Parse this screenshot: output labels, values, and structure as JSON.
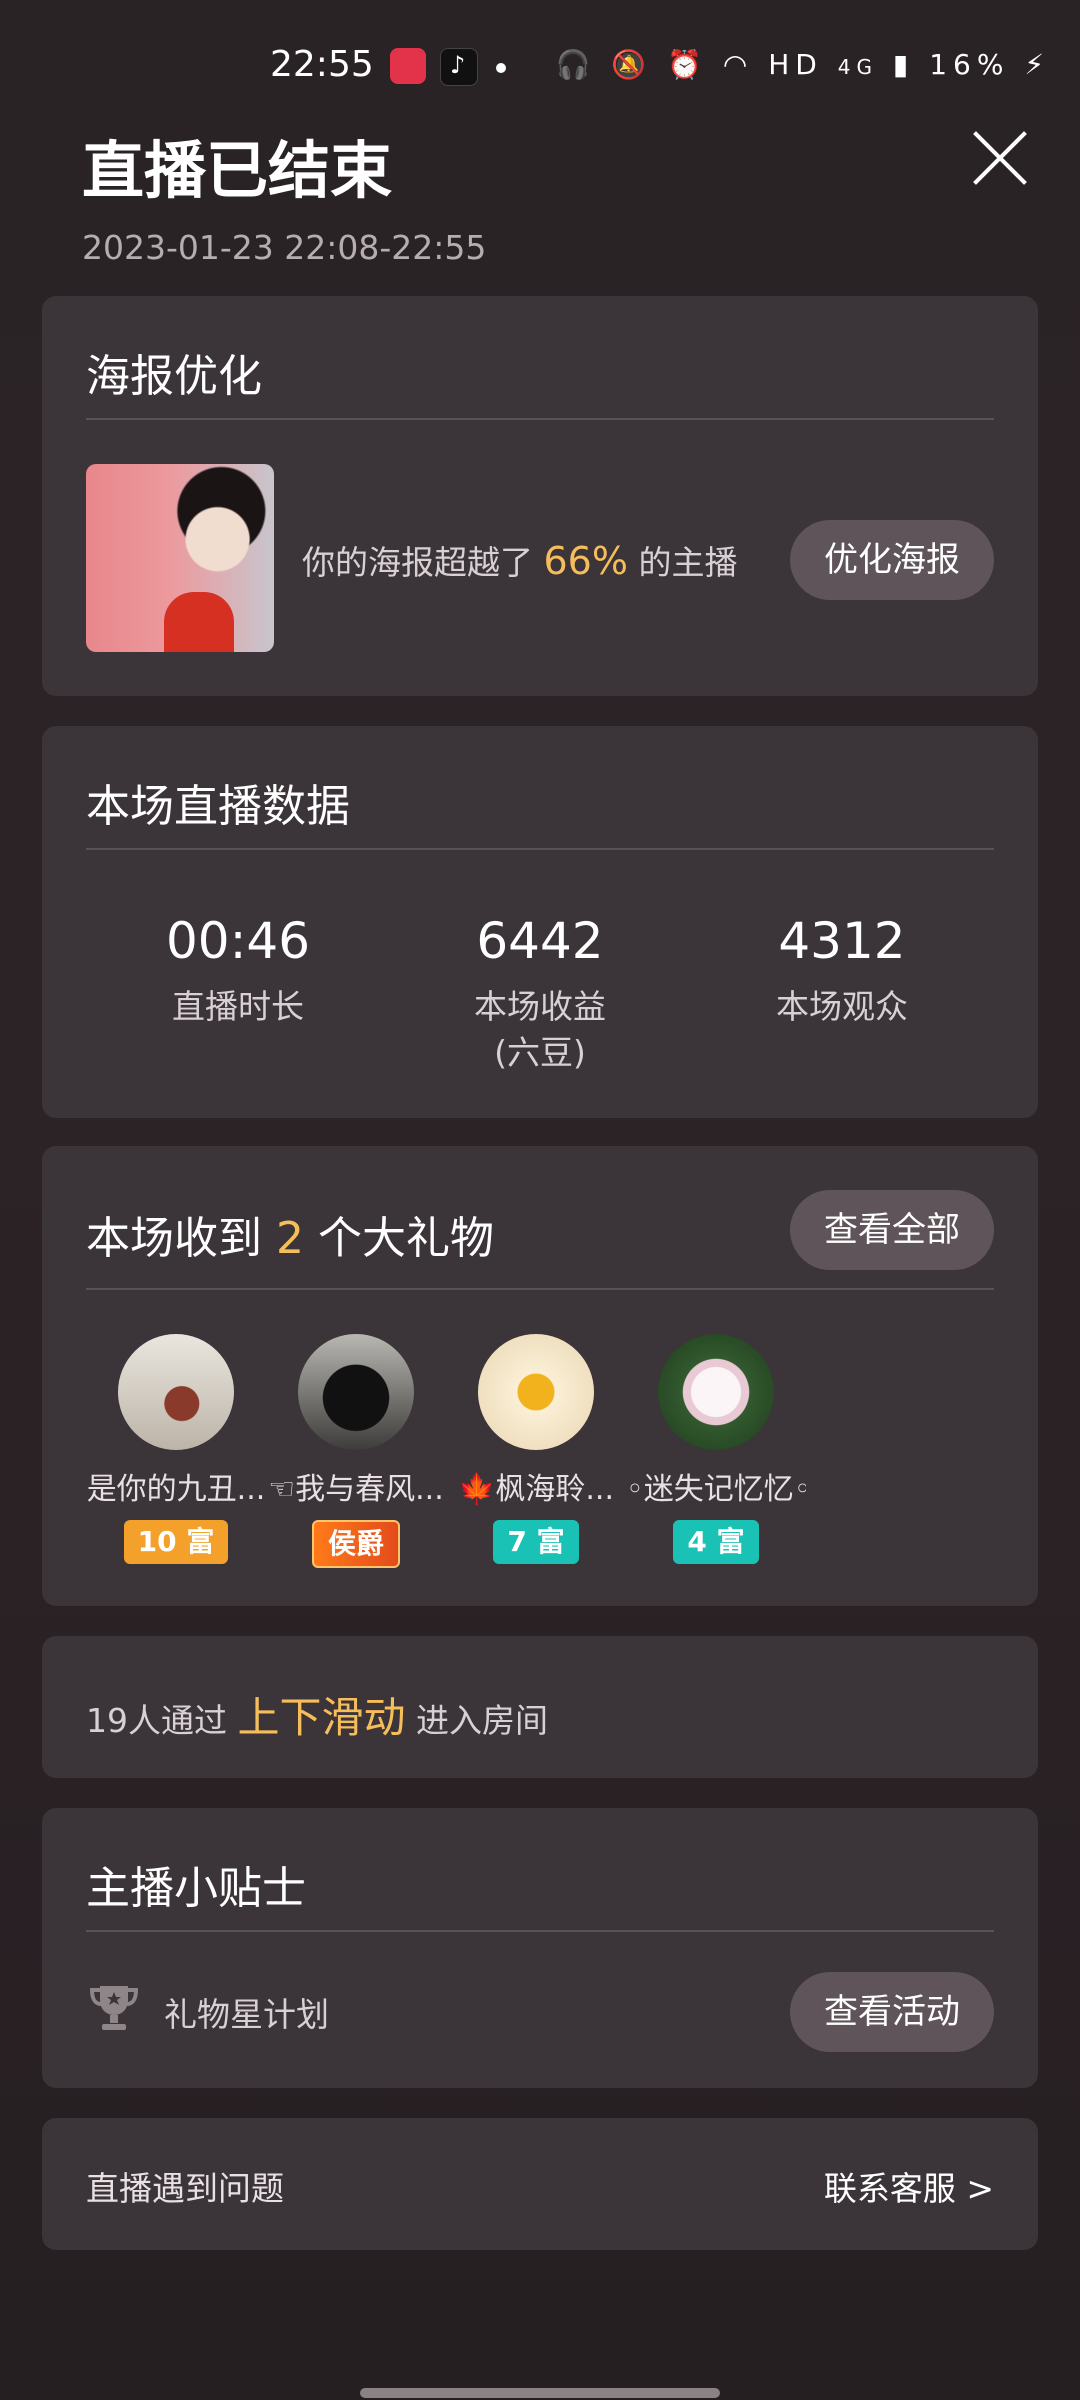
{
  "status_bar": {
    "time": "22:55",
    "network": "HD",
    "cellular": "4G",
    "battery": "16%",
    "icons": [
      "headset-icon",
      "mute-icon",
      "alarm-icon",
      "wifi-icon",
      "signal-icon",
      "charging-icon"
    ]
  },
  "header": {
    "title": "直播已结束",
    "date_range": "2023-01-23 22:08-22:55",
    "close_icon": "close-icon"
  },
  "poster": {
    "title": "海报优化",
    "text_before": "你的海报超越了",
    "percent": "66%",
    "text_after": "的主播",
    "button": "优化海报"
  },
  "live_data": {
    "title": "本场直播数据",
    "stats": [
      {
        "value": "00:46",
        "label": "直播时长",
        "sublabel": ""
      },
      {
        "value": "6442",
        "label": "本场收益",
        "sublabel": "(六豆)"
      },
      {
        "value": "4312",
        "label": "本场观众",
        "sublabel": ""
      }
    ]
  },
  "gifts": {
    "title_before": "本场收到",
    "count": "2",
    "title_after": "个大礼物",
    "button": "查看全部",
    "gifters": [
      {
        "name": "是你的九丑...",
        "badge": "10 富"
      },
      {
        "name": "☜我与春风...",
        "badge": "侯爵"
      },
      {
        "name": "🍁枫海聆...",
        "badge": "7 富"
      },
      {
        "name": "◦迷失记忆忆◦",
        "badge": "4 富"
      }
    ]
  },
  "swipe": {
    "text_before": "19人通过",
    "highlight": "上下滑动",
    "text_after": "进入房间"
  },
  "tips": {
    "title": "主播小贴士",
    "item": "礼物星计划",
    "icon": "trophy-icon",
    "button": "查看活动"
  },
  "support": {
    "problem": "直播遇到问题",
    "link": "联系客服 >"
  },
  "colors": {
    "accent": "#f6be5a",
    "card": "#3b3438",
    "pill": "#5f5459"
  }
}
